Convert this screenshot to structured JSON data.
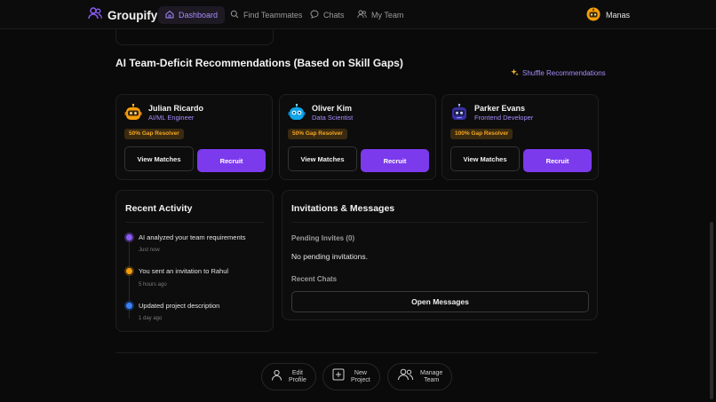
{
  "nav": {
    "brand": "Groupify",
    "items": [
      {
        "label": "Dashboard",
        "icon": "home-icon",
        "active": true
      },
      {
        "label": "Find Teammates",
        "icon": "search-icon",
        "active": false
      },
      {
        "label": "Chats",
        "icon": "chat-icon",
        "active": false
      },
      {
        "label": "My Team",
        "icon": "users-icon",
        "active": false
      }
    ],
    "user_name": "Manas"
  },
  "recommendations": {
    "title": "AI Team-Deficit Recommendations (Based on Skill Gaps)",
    "shuffle_label": "Shuffle Recommendations",
    "cards": [
      {
        "name": "Julian Ricardo",
        "role": "AI/ML Engineer",
        "badge": "50% Gap Resolver",
        "view_label": "View Matches",
        "recruit_label": "Recruit",
        "avatar": "orange-bot"
      },
      {
        "name": "Oliver Kim",
        "role": "Data Scientist",
        "badge": "50% Gap Resolver",
        "view_label": "View Matches",
        "recruit_label": "Recruit",
        "avatar": "blue-bot"
      },
      {
        "name": "Parker Evans",
        "role": "Frontend Developer",
        "badge": "100% Gap Resolver",
        "view_label": "View Matches",
        "recruit_label": "Recruit",
        "avatar": "navy-bot"
      }
    ]
  },
  "activity": {
    "title": "Recent Activity",
    "items": [
      {
        "text": "AI analyzed your team requirements",
        "time": "Just now",
        "color": "#8b5cf6"
      },
      {
        "text": "You sent an invitation to Rahul",
        "time": "5 hours ago",
        "color": "#f59e0b"
      },
      {
        "text": "Updated project description",
        "time": "1 day ago",
        "color": "#3b82f6"
      }
    ]
  },
  "invitations": {
    "title": "Invitations & Messages",
    "pending_label": "Pending Invites (0)",
    "empty_text": "No pending invitations.",
    "chats_label": "Recent Chats",
    "open_label": "Open Messages"
  },
  "quick_actions": [
    {
      "line1": "Edit",
      "line2": "Profile",
      "icon": "user-icon"
    },
    {
      "line1": "New",
      "line2": "Project",
      "icon": "plus-square-icon"
    },
    {
      "line1": "Manage",
      "line2": "Team",
      "icon": "users-icon"
    }
  ],
  "colors": {
    "accent": "#7c3aed",
    "accent_text": "#a78bfa",
    "badge_text": "#f5a623",
    "background": "#0a0a0a"
  }
}
